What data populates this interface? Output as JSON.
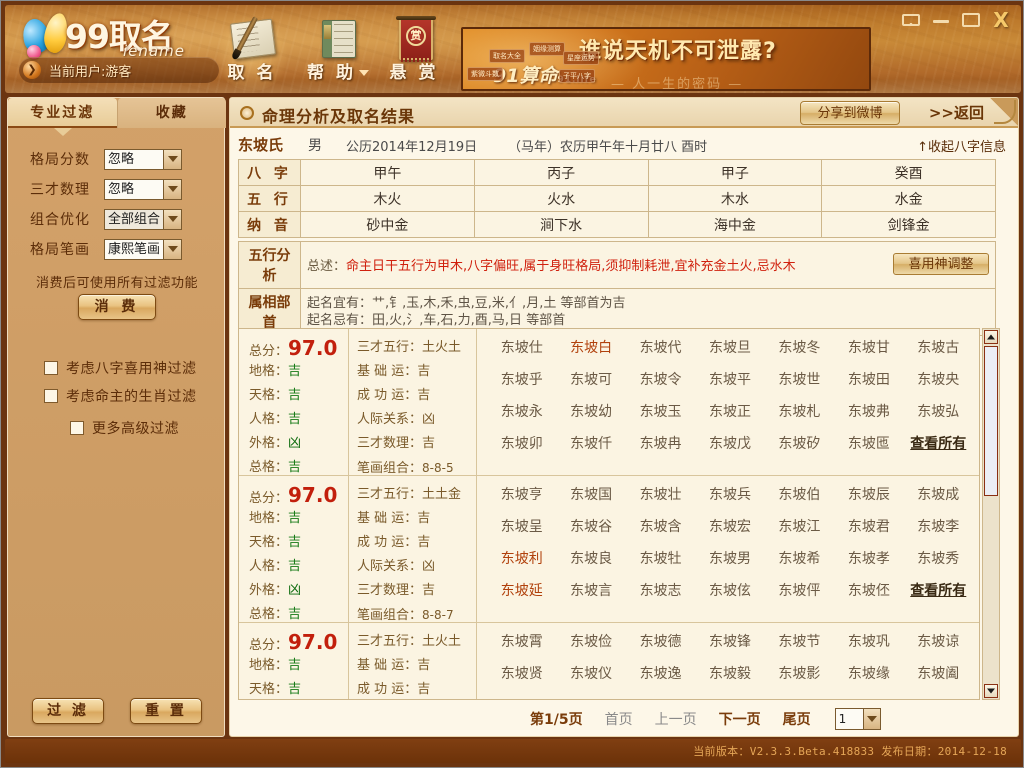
{
  "window": {
    "buttons": [
      {
        "name": "message-button",
        "glyph": "envelope"
      },
      {
        "name": "minimize-button",
        "glyph": "minimize"
      },
      {
        "name": "maximize-button",
        "glyph": "maximize"
      },
      {
        "name": "close-button",
        "glyph": "X"
      }
    ]
  },
  "brand": {
    "wordmark": "99取名",
    "subtitle": "iename",
    "user_label": "当前用户:游客",
    "user_arrow": "❯"
  },
  "toolbar": {
    "items": [
      {
        "label": "取 名",
        "icon": "brush-paper-icon",
        "has_caret": false
      },
      {
        "label": "帮 助",
        "icon": "book-icon",
        "has_caret": true
      },
      {
        "label": "悬 赏",
        "icon": "reward-banner-icon",
        "has_caret": false
      }
    ]
  },
  "ad": {
    "headline": "谁说天机不可泄露?",
    "brand": "91算命",
    "brand_small": "91.life",
    "chips": [
      "取名大全",
      "姻缘测算",
      "星座运势",
      "紫微斗数",
      "子平八字"
    ],
    "wave": "— 人一生的密码 —"
  },
  "sidebar": {
    "tabs": [
      {
        "label": "专业过滤",
        "active": true
      },
      {
        "label": "收藏",
        "active": false
      }
    ],
    "filters": [
      {
        "label": "格局分数",
        "value": "忽略"
      },
      {
        "label": "三才数理",
        "value": "忽略"
      },
      {
        "label": "组合优化",
        "value": "全部组合"
      },
      {
        "label": "格局笔画",
        "value": "康熙笔画"
      }
    ],
    "hint": "消费后可使用所有过滤功能",
    "pay_button": "消 费",
    "checkboxes": [
      {
        "label": "考虑八字喜用神过滤",
        "checked": false
      },
      {
        "label": "考虑命主的生肖过滤",
        "checked": false
      },
      {
        "label": "更多高级过滤",
        "checked": false
      }
    ],
    "actions": [
      {
        "label": "过 滤"
      },
      {
        "label": "重 置"
      }
    ]
  },
  "main": {
    "title": "命理分析及取名结果",
    "share_button": "分享到微博",
    "back_link": ">>返回",
    "person": {
      "name": "东坡氏",
      "gender": "男",
      "solar_date": "公历2014年12月19日",
      "lunar_date": "（马年）农历甲午年十月廿八 酉时",
      "collapse_link": "↑收起八字信息"
    },
    "bazi_table": {
      "rows": [
        {
          "header": "八 字",
          "cells": [
            "甲午",
            "丙子",
            "甲子",
            "癸酉"
          ]
        },
        {
          "header": "五 行",
          "cells": [
            "木火",
            "火水",
            "木水",
            "水金"
          ]
        },
        {
          "header": "纳 音",
          "cells": [
            "砂中金",
            "涧下水",
            "海中金",
            "剑锋金"
          ]
        }
      ]
    },
    "wuxing": {
      "header": "五行分析",
      "summary_label": "总述：",
      "summary_text": "命主日干五行为甲木,八字偏旺,属于身旺格局,须抑制耗泄,宜补充金土火,忌水木",
      "adjust_button": "喜用神调整"
    },
    "radicals": {
      "header": "属相部首",
      "line1": "起名宜有：艹,钅,玉,木,禾,虫,豆,米,亻,月,土 等部首为吉",
      "line2": "起名忌有：田,火,氵,车,石,力,酉,马,日 等部首"
    },
    "results": [
      {
        "score_label": "总分：",
        "score": "97.0",
        "score_lines": [
          {
            "label": "地格：",
            "value": "吉",
            "cls": "ji"
          },
          {
            "label": "天格：",
            "value": "吉",
            "cls": "ji"
          },
          {
            "label": "人格：",
            "value": "吉",
            "cls": "ji"
          },
          {
            "label": "外格：",
            "value": "凶",
            "cls": "xiong"
          },
          {
            "label": "总格：",
            "value": "吉",
            "cls": "ji"
          }
        ],
        "meta_lines": [
          {
            "label": "三才五行：",
            "value": "土火土"
          },
          {
            "label": "基 础 运：",
            "value": "吉"
          },
          {
            "label": "成 功 运：",
            "value": "吉"
          },
          {
            "label": "人际关系：",
            "value": "凶"
          },
          {
            "label": "三才数理：",
            "value": "吉"
          },
          {
            "label": "笔画组合：",
            "value": "8-8-5"
          }
        ],
        "names": [
          {
            "t": "东坡仕"
          },
          {
            "t": "东坡白",
            "hl": true
          },
          {
            "t": "东坡代"
          },
          {
            "t": "东坡旦"
          },
          {
            "t": "东坡冬"
          },
          {
            "t": "东坡甘"
          },
          {
            "t": "东坡古"
          },
          {
            "t": "东坡乎"
          },
          {
            "t": "东坡可"
          },
          {
            "t": "东坡令"
          },
          {
            "t": "东坡平"
          },
          {
            "t": "东坡世"
          },
          {
            "t": "东坡田"
          },
          {
            "t": "东坡央"
          },
          {
            "t": "东坡永"
          },
          {
            "t": "东坡幼"
          },
          {
            "t": "东坡玉"
          },
          {
            "t": "东坡正"
          },
          {
            "t": "东坡札"
          },
          {
            "t": "东坡弗"
          },
          {
            "t": "东坡弘"
          },
          {
            "t": "东坡卯"
          },
          {
            "t": "东坡仟"
          },
          {
            "t": "东坡冉"
          },
          {
            "t": "东坡戊"
          },
          {
            "t": "东坡矽"
          },
          {
            "t": "东坡匜"
          },
          {
            "t": "查看所有",
            "all": true
          }
        ]
      },
      {
        "score_label": "总分：",
        "score": "97.0",
        "score_lines": [
          {
            "label": "地格：",
            "value": "吉",
            "cls": "ji"
          },
          {
            "label": "天格：",
            "value": "吉",
            "cls": "ji"
          },
          {
            "label": "人格：",
            "value": "吉",
            "cls": "ji"
          },
          {
            "label": "外格：",
            "value": "凶",
            "cls": "xiong"
          },
          {
            "label": "总格：",
            "value": "吉",
            "cls": "ji"
          }
        ],
        "meta_lines": [
          {
            "label": "三才五行：",
            "value": "土土金"
          },
          {
            "label": "基 础 运：",
            "value": "吉"
          },
          {
            "label": "成 功 运：",
            "value": "吉"
          },
          {
            "label": "人际关系：",
            "value": "凶"
          },
          {
            "label": "三才数理：",
            "value": "吉"
          },
          {
            "label": "笔画组合：",
            "value": "8-8-7"
          }
        ],
        "names": [
          {
            "t": "东坡亨"
          },
          {
            "t": "东坡国"
          },
          {
            "t": "东坡壮"
          },
          {
            "t": "东坡兵"
          },
          {
            "t": "东坡伯"
          },
          {
            "t": "东坡辰"
          },
          {
            "t": "东坡成"
          },
          {
            "t": "东坡呈"
          },
          {
            "t": "东坡谷"
          },
          {
            "t": "东坡含"
          },
          {
            "t": "东坡宏"
          },
          {
            "t": "东坡江"
          },
          {
            "t": "东坡君"
          },
          {
            "t": "东坡李"
          },
          {
            "t": "东坡利",
            "hl": true
          },
          {
            "t": "东坡良"
          },
          {
            "t": "东坡牡"
          },
          {
            "t": "东坡男"
          },
          {
            "t": "东坡希"
          },
          {
            "t": "东坡孝"
          },
          {
            "t": "东坡秀"
          },
          {
            "t": "东坡延",
            "hl": true
          },
          {
            "t": "东坡言"
          },
          {
            "t": "东坡志"
          },
          {
            "t": "东坡伭"
          },
          {
            "t": "东坡伻"
          },
          {
            "t": "东坡伾"
          },
          {
            "t": "查看所有",
            "all": true
          }
        ]
      },
      {
        "score_label": "总分：",
        "score": "97.0",
        "score_lines": [
          {
            "label": "地格：",
            "value": "吉",
            "cls": "ji"
          },
          {
            "label": "天格：",
            "value": "吉",
            "cls": "ji"
          }
        ],
        "meta_lines": [
          {
            "label": "三才五行：",
            "value": "土火土"
          },
          {
            "label": "基 础 运：",
            "value": "吉"
          },
          {
            "label": "成 功 运：",
            "value": "吉"
          }
        ],
        "names": [
          {
            "t": "东坡霄"
          },
          {
            "t": "东坡俭"
          },
          {
            "t": "东坡德"
          },
          {
            "t": "东坡锋"
          },
          {
            "t": "东坡节"
          },
          {
            "t": "东坡巩"
          },
          {
            "t": "东坡谅"
          },
          {
            "t": "东坡贤"
          },
          {
            "t": "东坡仪"
          },
          {
            "t": "东坡逸"
          },
          {
            "t": "东坡毅"
          },
          {
            "t": "东坡影"
          },
          {
            "t": "东坡缘"
          },
          {
            "t": "东坡阖"
          }
        ]
      }
    ],
    "pager": {
      "info": "第1/5页",
      "links": [
        {
          "label": "首页",
          "on": false
        },
        {
          "label": "上一页",
          "on": false
        },
        {
          "label": "下一页",
          "on": true
        },
        {
          "label": "尾页",
          "on": true
        }
      ],
      "current_page": "1"
    }
  },
  "status": {
    "text": "当前版本：V2.3.3.Beta.418833  发布日期：2014-12-18"
  },
  "colors": {
    "accent": "#7a3c0a",
    "score_red": "#c21f0c",
    "good_green": "#167a16",
    "warn_red": "#d0210e",
    "panel_bg": "#fbf4e2",
    "sidebar_bg": "#c99a62"
  }
}
